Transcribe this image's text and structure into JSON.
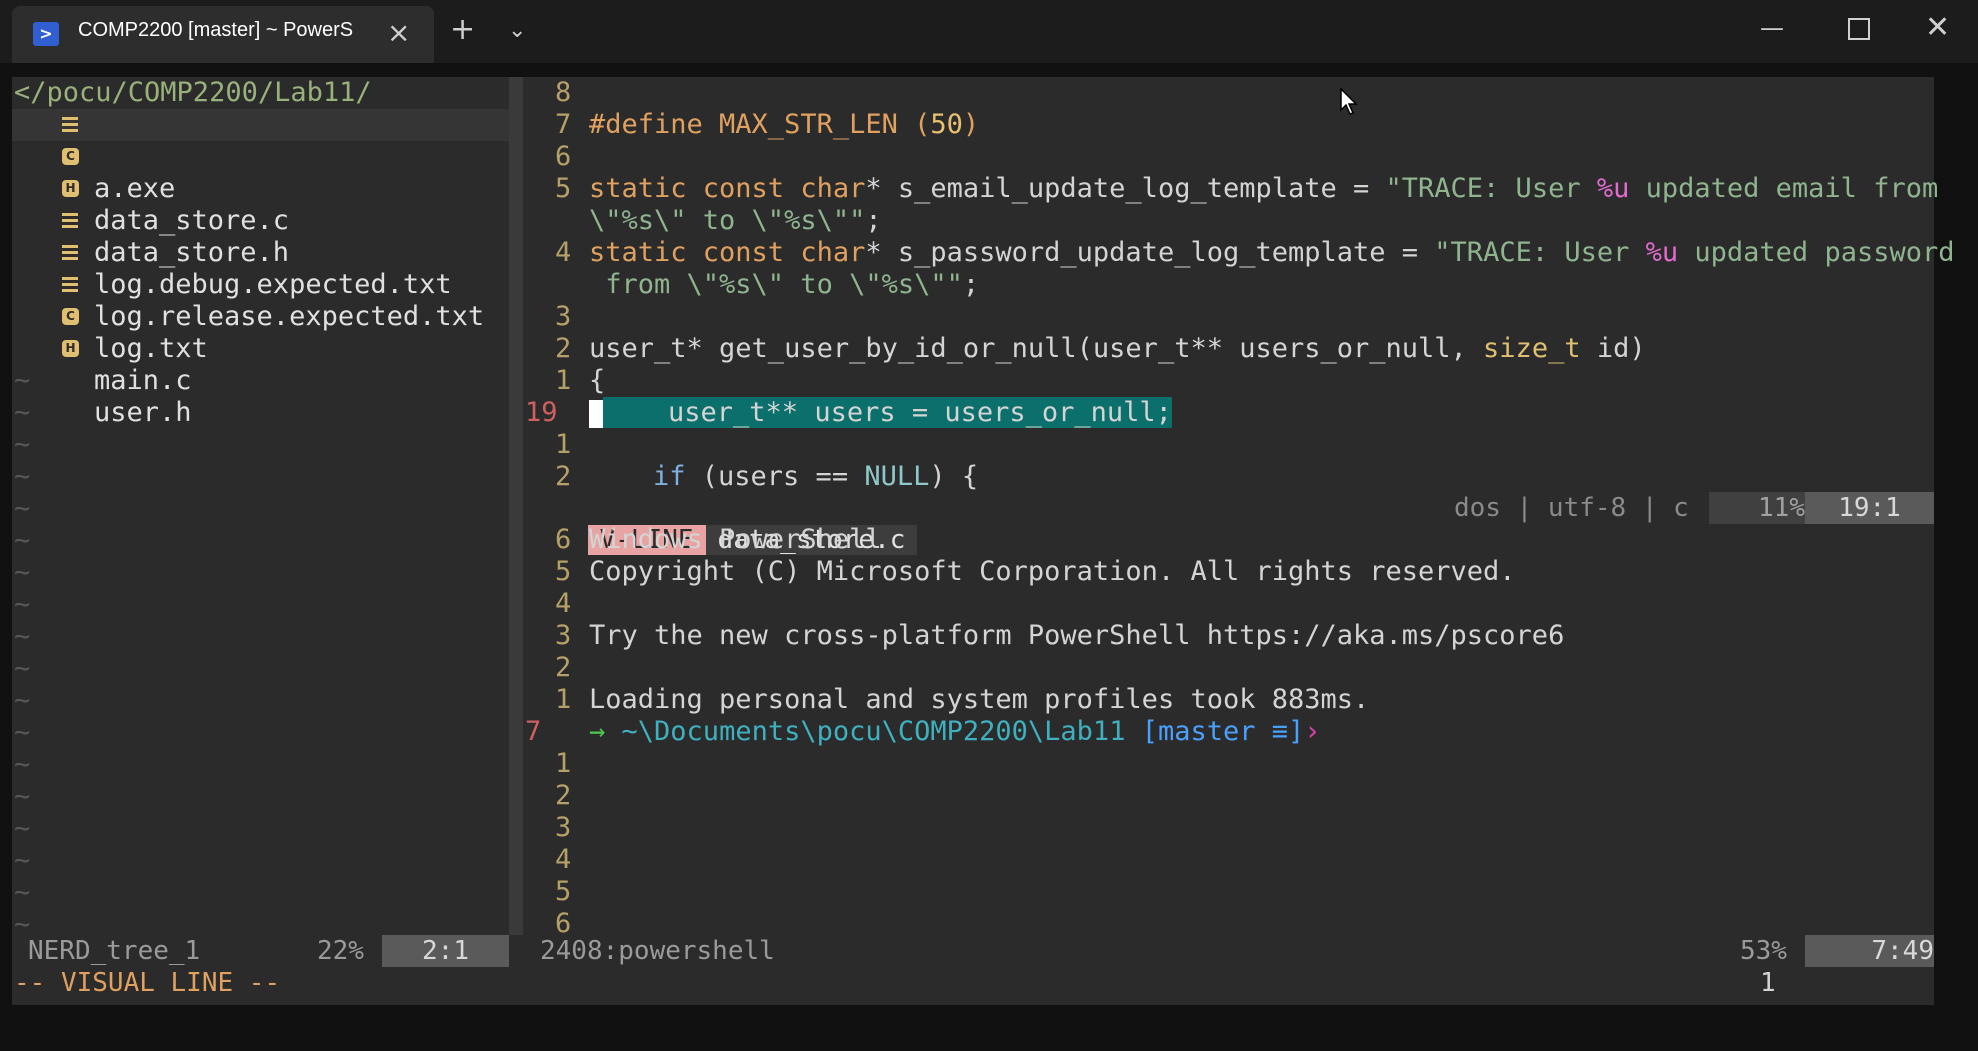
{
  "window": {
    "tab_title": "COMP2200 [master] ~ PowerS",
    "tab_icon": "powershell-icon",
    "new_tab_icon": "plus-icon",
    "dropdown_icon": "chevron-down-icon",
    "minimize_icon": "minimize-icon",
    "maximize_icon": "maximize-icon",
    "close_icon": "close-icon"
  },
  "tree": {
    "root": "</pocu/COMP2200/Lab11/",
    "files": [
      {
        "name": "a.exe",
        "icon": "text-file-icon",
        "selected": true
      },
      {
        "name": "data_store.c",
        "icon": "c-file-icon",
        "badge": "C"
      },
      {
        "name": "data_store.h",
        "icon": "h-file-icon",
        "badge": "H"
      },
      {
        "name": "log.debug.expected.txt",
        "icon": "text-file-icon"
      },
      {
        "name": "log.release.expected.txt",
        "icon": "text-file-icon"
      },
      {
        "name": "log.txt",
        "icon": "text-file-icon"
      },
      {
        "name": "main.c",
        "icon": "c-file-icon",
        "badge": "C"
      },
      {
        "name": "user.h",
        "icon": "h-file-icon",
        "badge": "H"
      }
    ],
    "tilde": "~",
    "status_name": "NERD_tree_1",
    "status_pct": "22%",
    "status_pos": "2:1"
  },
  "editor": {
    "lines": {
      "l8": "8",
      "l7": "7",
      "l6": "6",
      "l5": "5",
      "l4": "4",
      "l3": "3",
      "l2": "2",
      "l1": "1",
      "l19": "19",
      "l1b": "1",
      "l2b": "2"
    },
    "code": {
      "define_kw": "#define MAX_STR_LEN (",
      "define_num": "50",
      "define_close": ")",
      "s1_static": "static const char",
      "s1_rest": "* s_email_update_log_template = ",
      "s1_str_a": "\"TRACE: User ",
      "s1_fmt": "%u",
      "s1_str_b": " updated email from",
      "s1_wrap_a": "\\\"%s\\\" to \\\"%s\\\"\"",
      "s1_wrap_b": ";",
      "s2_static": "static const char",
      "s2_rest": "* s_password_update_log_template = ",
      "s2_str_a": "\"TRACE: User ",
      "s2_fmt": "%u",
      "s2_str_b": " updated password",
      "s2_wrap_a": " from \\\"%s\\\" to \\\"%s\\\"\"",
      "s2_wrap_b": ";",
      "fn_a": "user_t* get_user_by_id_or_null(user_t** users_or_null, ",
      "fn_type": "size_t",
      "fn_b": " id)",
      "brace": "{",
      "hl": "    user_t** users = users_or_null;",
      "if_kw": "if",
      "if_a": " (users == ",
      "if_null": "NULL",
      "if_b": ") {"
    },
    "status": {
      "mode": "V-LINE",
      "file": "data_store.c",
      "info": "dos | utf-8 | c ",
      "pct": "11%",
      "pos": "19:1"
    }
  },
  "shell": {
    "nums": [
      "6",
      "5",
      "4",
      "3",
      "2",
      "1",
      "7",
      "1",
      "2",
      "3",
      "4",
      "5",
      "6"
    ],
    "line_ps": "Windows PowerShell",
    "line_copy": "Copyright (C) Microsoft Corporation. All rights reserved.",
    "line_try": "Try the new cross-platform PowerShell https://aka.ms/pscore6",
    "line_load": "Loading personal and system profiles took 883ms.",
    "prompt_arrow": "→",
    "prompt_path": "~\\Documents\\pocu\\COMP2200\\Lab11",
    "prompt_branch": "[master ≡]",
    "prompt_chevron": "›",
    "status_name": "2408:powershell",
    "status_pct": "53%",
    "status_pos": "7:49"
  },
  "cmdline": {
    "mode": "-- VISUAL LINE --",
    "right": "1"
  }
}
